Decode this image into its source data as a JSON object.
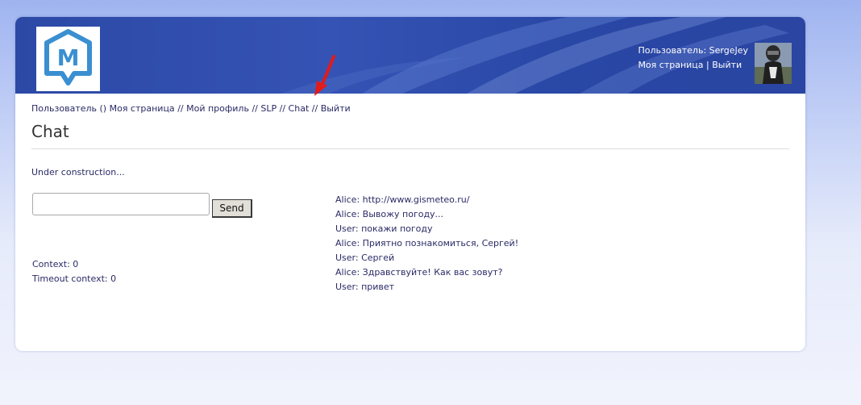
{
  "header": {
    "logo_letter": "M",
    "user_line": "Пользователь: SergeJey",
    "my_page_link": "Моя страница",
    "separator": "|",
    "logout_link": "Выйти"
  },
  "breadcrumbs": {
    "prefix": "Пользователь ()",
    "items": [
      "Моя страница",
      "Мой профиль",
      "SLP",
      "Chat",
      "Выйти"
    ],
    "separator": "//"
  },
  "page": {
    "title": "Chat",
    "note": "Under construction..."
  },
  "chat_form": {
    "input_value": "",
    "send_label": "Send"
  },
  "context": {
    "context_label": "Context: 0",
    "timeout_label": "Timeout context: 0"
  },
  "chat_log": [
    "Alice: http://www.gismeteo.ru/",
    "Alice: Вывожу погоду...",
    "User: покажи погоду",
    "Alice: Приятно познакомиться, Сергей!",
    "User: Сергей",
    "Alice: Здравствуйте! Как вас зовут?",
    "User: привет"
  ],
  "colors": {
    "banner": "#2c49a6",
    "logo_blue": "#3a8fd1",
    "link_text": "#2a2a66",
    "annotation_arrow": "#e21b1b"
  }
}
